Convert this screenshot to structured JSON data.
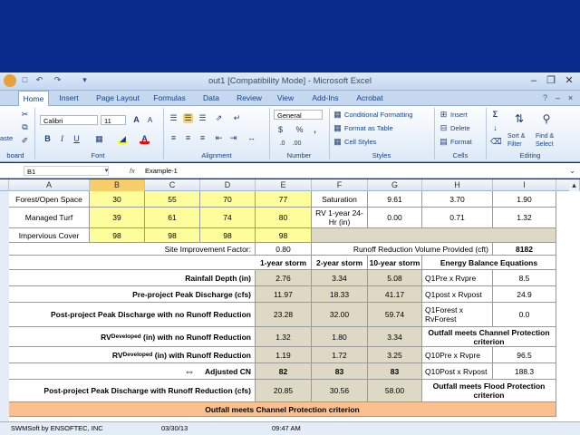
{
  "window": {
    "title": "out1  [Compatibility Mode] - Microsoft Excel"
  },
  "tabs": [
    "Home",
    "Insert",
    "Page Layout",
    "Formulas",
    "Data",
    "Review",
    "View",
    "Add-Ins",
    "Acrobat"
  ],
  "ribbon": {
    "clipboard_label": "board",
    "paste_label": "aste",
    "font_name": "Calibri",
    "font_size": "11",
    "font_group_label": "Font",
    "alignment_label": "Alignment",
    "number_format": "General",
    "number_label": "Number",
    "conditional_formatting": "Conditional Formatting",
    "format_as_table": "Format as Table",
    "cell_styles": "Cell Styles",
    "styles_label": "Styles",
    "insert": "Insert",
    "delete": "Delete",
    "format": "Format",
    "cells_label": "Cells",
    "sort_filter": "Sort & Filter",
    "find_select": "Find & Select",
    "editing_label": "Editing"
  },
  "formula_bar": {
    "name_box": "B1",
    "fx": "fx",
    "content": "Example-1"
  },
  "columns": [
    "A",
    "B",
    "C",
    "D",
    "E",
    "F",
    "G",
    "H",
    "I"
  ],
  "landcover": [
    {
      "name": "Forest/Open Space",
      "b": "30",
      "c": "55",
      "d": "70",
      "e": "77",
      "f": "Saturation",
      "g": "9.61",
      "h": "3.70",
      "i": "1.90"
    },
    {
      "name": "Managed Turf",
      "b": "39",
      "c": "61",
      "d": "74",
      "e": "80",
      "f": "RV 1-year 24-Hr (in)",
      "g": "0.00",
      "h": "0.71",
      "i": "1.32"
    },
    {
      "name": "Impervious Cover",
      "b": "98",
      "c": "98",
      "d": "98",
      "e": "98"
    }
  ],
  "site_factor": {
    "label": "Site Improvement Factor:",
    "value": "0.80"
  },
  "runoff_reduction": {
    "label": "Runoff Reduction Volume Provided (cft)",
    "value": "8182"
  },
  "storm_headers": [
    "1-year storm",
    "2-year storm",
    "10-year storm"
  ],
  "energy_title": "Energy Balance Equations",
  "storm_rows": [
    {
      "label": "Rainfall Depth (in)",
      "v1": "2.76",
      "v2": "3.34",
      "v3": "5.08"
    },
    {
      "label": "Pre-project Peak Discharge (cfs)",
      "v1": "11.97",
      "v2": "18.33",
      "v3": "41.17"
    },
    {
      "label": "Post-project Peak Discharge with no Runoff Reduction",
      "v1": "23.28",
      "v2": "32.00",
      "v3": "59.74"
    },
    {
      "label_main": "RV",
      "label_sub": "Developed",
      "label_rest": " (in) with no Runoff Reduction",
      "v1": "1.32",
      "v2": "1.80",
      "v3": "3.34"
    },
    {
      "label_main": "RV",
      "label_sub": "Developed",
      "label_rest": " (in) with Runoff Reduction",
      "v1": "1.19",
      "v2": "1.72",
      "v3": "3.25"
    },
    {
      "label": "Adjusted CN",
      "v1": "82",
      "v2": "83",
      "v3": "83"
    },
    {
      "label": "Post-project Peak Discharge with Runoff Reduction  (cfs)",
      "v1": "20.85",
      "v2": "30.56",
      "v3": "58.00"
    }
  ],
  "energy": [
    {
      "label": "Q1Pre x Rvpre",
      "value": "8.5"
    },
    {
      "label": "Q1post x Rvpost",
      "value": "24.9"
    },
    {
      "label": "Q1Forest x RvForest",
      "value": "0.0"
    },
    {
      "label": "Q10Pre x Rvpre",
      "value": "96.5"
    },
    {
      "label": "Q10Post x Rvpost",
      "value": "188.3"
    }
  ],
  "channel_status": "Outfall meets Channel Protection criterion",
  "flood_status": "Outfall meets Flood Protection criterion",
  "banner": "Outfall meets Channel Protection criterion",
  "footer": {
    "left": "SWMSoft by ENSOFTEC, INC",
    "date": "03/30/13",
    "time": "09:47 AM"
  },
  "colors": {
    "highlight_yellow": "#fdfd9b",
    "result_tan": "#ddd9c4",
    "banner_orange": "#fac090",
    "ribbon_blue": "#c5d8f0"
  }
}
